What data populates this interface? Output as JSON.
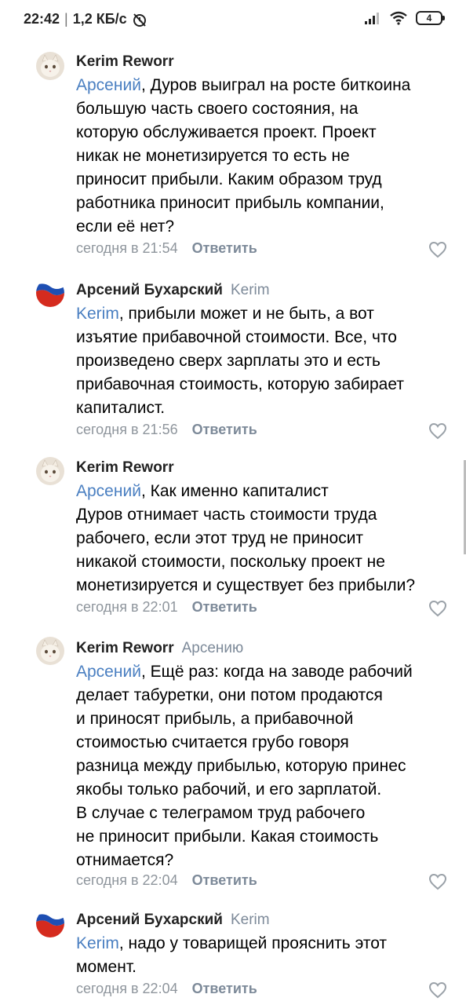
{
  "status_bar": {
    "time": "22:42",
    "separator": "|",
    "net_speed": "1,2 КБ/с",
    "battery_level": "4"
  },
  "comments": [
    {
      "author": "Kerim Reworr",
      "reply_to": "",
      "avatar": "cat-avatar",
      "mention": "Арсений",
      "lines": [
        ", Дуров выиграл на росте биткоина",
        "большую часть своего состояния, на",
        "которую обслуживается проект. Проект",
        "никак не монетизируется то есть не",
        "приносит прибыли. Каким образом труд",
        "работника приносит прибыль компании,",
        "если её нет?"
      ],
      "time": "сегодня в 21:54",
      "reply_label": "Ответить"
    },
    {
      "author": "Арсений Бухарский",
      "reply_to": "Kerim",
      "avatar": "russian-flag-avatar",
      "mention": "Kerim",
      "lines": [
        ", прибыли может и не быть, а вот",
        "изъятие прибавочной стоимости. Все, что",
        "произведено сверх зарплаты это и есть",
        "прибавочная стоимость, которую забирает",
        "капиталист."
      ],
      "time": "сегодня в 21:56",
      "reply_label": "Ответить"
    },
    {
      "author": "Kerim Reworr",
      "reply_to": "",
      "avatar": "cat-avatar",
      "mention": "Арсений",
      "lines": [
        ", Как именно капиталист",
        "Дуров отнимает часть стоимости труда",
        "рабочего, если этот труд не приносит",
        "никакой стоимости, поскольку проект не",
        "монетизируется и существует без прибыли?"
      ],
      "time": "сегодня в 22:01",
      "reply_label": "Ответить"
    },
    {
      "author": "Kerim Reworr",
      "reply_to": "Арсению",
      "avatar": "cat-avatar",
      "mention": "Арсений",
      "lines": [
        ", Ещё раз: когда на заводе рабочий",
        "делает табуретки, они потом продаются",
        "и приносят прибыль, а прибавочной",
        "стоимостью считается грубо говоря",
        "разница между прибылью, которую принес",
        "якобы только рабочий, и его зарплатой.",
        "В случае с телеграмом труд рабочего",
        "не приносит прибыли. Какая стоимость",
        "отнимается?"
      ],
      "time": "сегодня в 22:04",
      "reply_label": "Ответить"
    },
    {
      "author": "Арсений Бухарский",
      "reply_to": "Kerim",
      "avatar": "russian-flag-avatar",
      "mention": "Kerim",
      "lines": [
        ", надо у товарищей прояснить этот",
        "момент."
      ],
      "time": "сегодня в 22:04",
      "reply_label": "Ответить"
    }
  ],
  "colors": {
    "mention": "#4a7fc1",
    "meta": "#8e959c",
    "reply_button": "#7d8a99"
  }
}
